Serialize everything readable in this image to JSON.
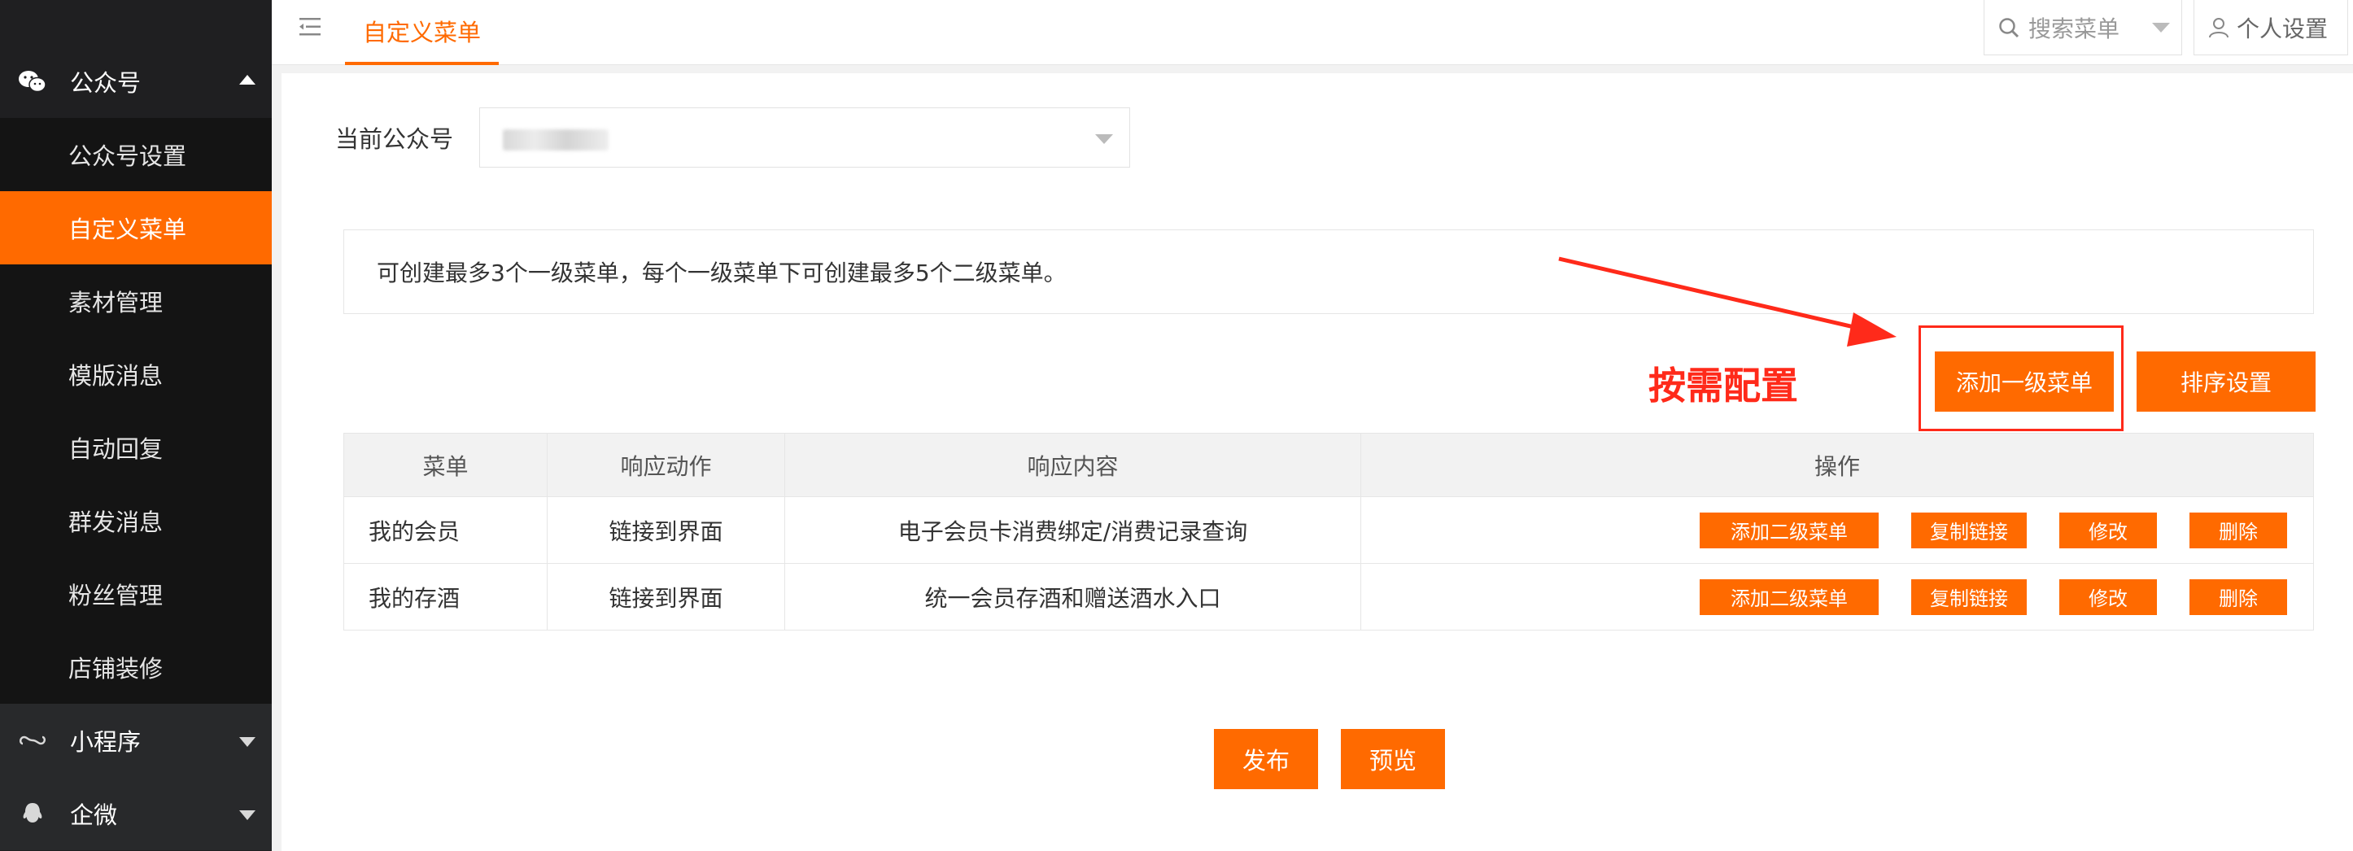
{
  "sidebar": {
    "groups": [
      {
        "label": "公众号",
        "icon": "wechat-icon",
        "expanded": true
      },
      {
        "label": "小程序",
        "icon": "miniprogram-icon",
        "expanded": false
      },
      {
        "label": "企微",
        "icon": "wecom-icon",
        "expanded": false
      }
    ],
    "items": [
      {
        "label": "公众号设置",
        "active": false
      },
      {
        "label": "自定义菜单",
        "active": true
      },
      {
        "label": "素材管理",
        "active": false
      },
      {
        "label": "模版消息",
        "active": false
      },
      {
        "label": "自动回复",
        "active": false
      },
      {
        "label": "群发消息",
        "active": false
      },
      {
        "label": "粉丝管理",
        "active": false
      },
      {
        "label": "店铺装修",
        "active": false
      }
    ]
  },
  "topbar": {
    "active_tab": "自定义菜单",
    "search_placeholder": "搜索菜单",
    "user_settings": "个人设置"
  },
  "main": {
    "account_label": "当前公众号",
    "notice": "可创建最多3个一级菜单，每个一级菜单下可创建最多5个二级菜单。",
    "annotation": "按需配置",
    "add_top_menu": "添加一级菜单",
    "sort_settings": "排序设置",
    "table": {
      "headers": [
        "菜单",
        "响应动作",
        "响应内容",
        "操作"
      ],
      "rows": [
        {
          "menu": "我的会员",
          "action": "链接到界面",
          "content": "电子会员卡消费绑定/消费记录查询"
        },
        {
          "menu": "我的存酒",
          "action": "链接到界面",
          "content": "统一会员存酒和赠送酒水入口"
        }
      ],
      "row_ops": [
        "添加二级菜单",
        "复制链接",
        "修改",
        "删除"
      ]
    },
    "publish": "发布",
    "preview": "预览"
  },
  "colors": {
    "accent": "#ff6a00",
    "annotation": "#ff2a1a",
    "sidebar_bg": "#1f1f21"
  }
}
